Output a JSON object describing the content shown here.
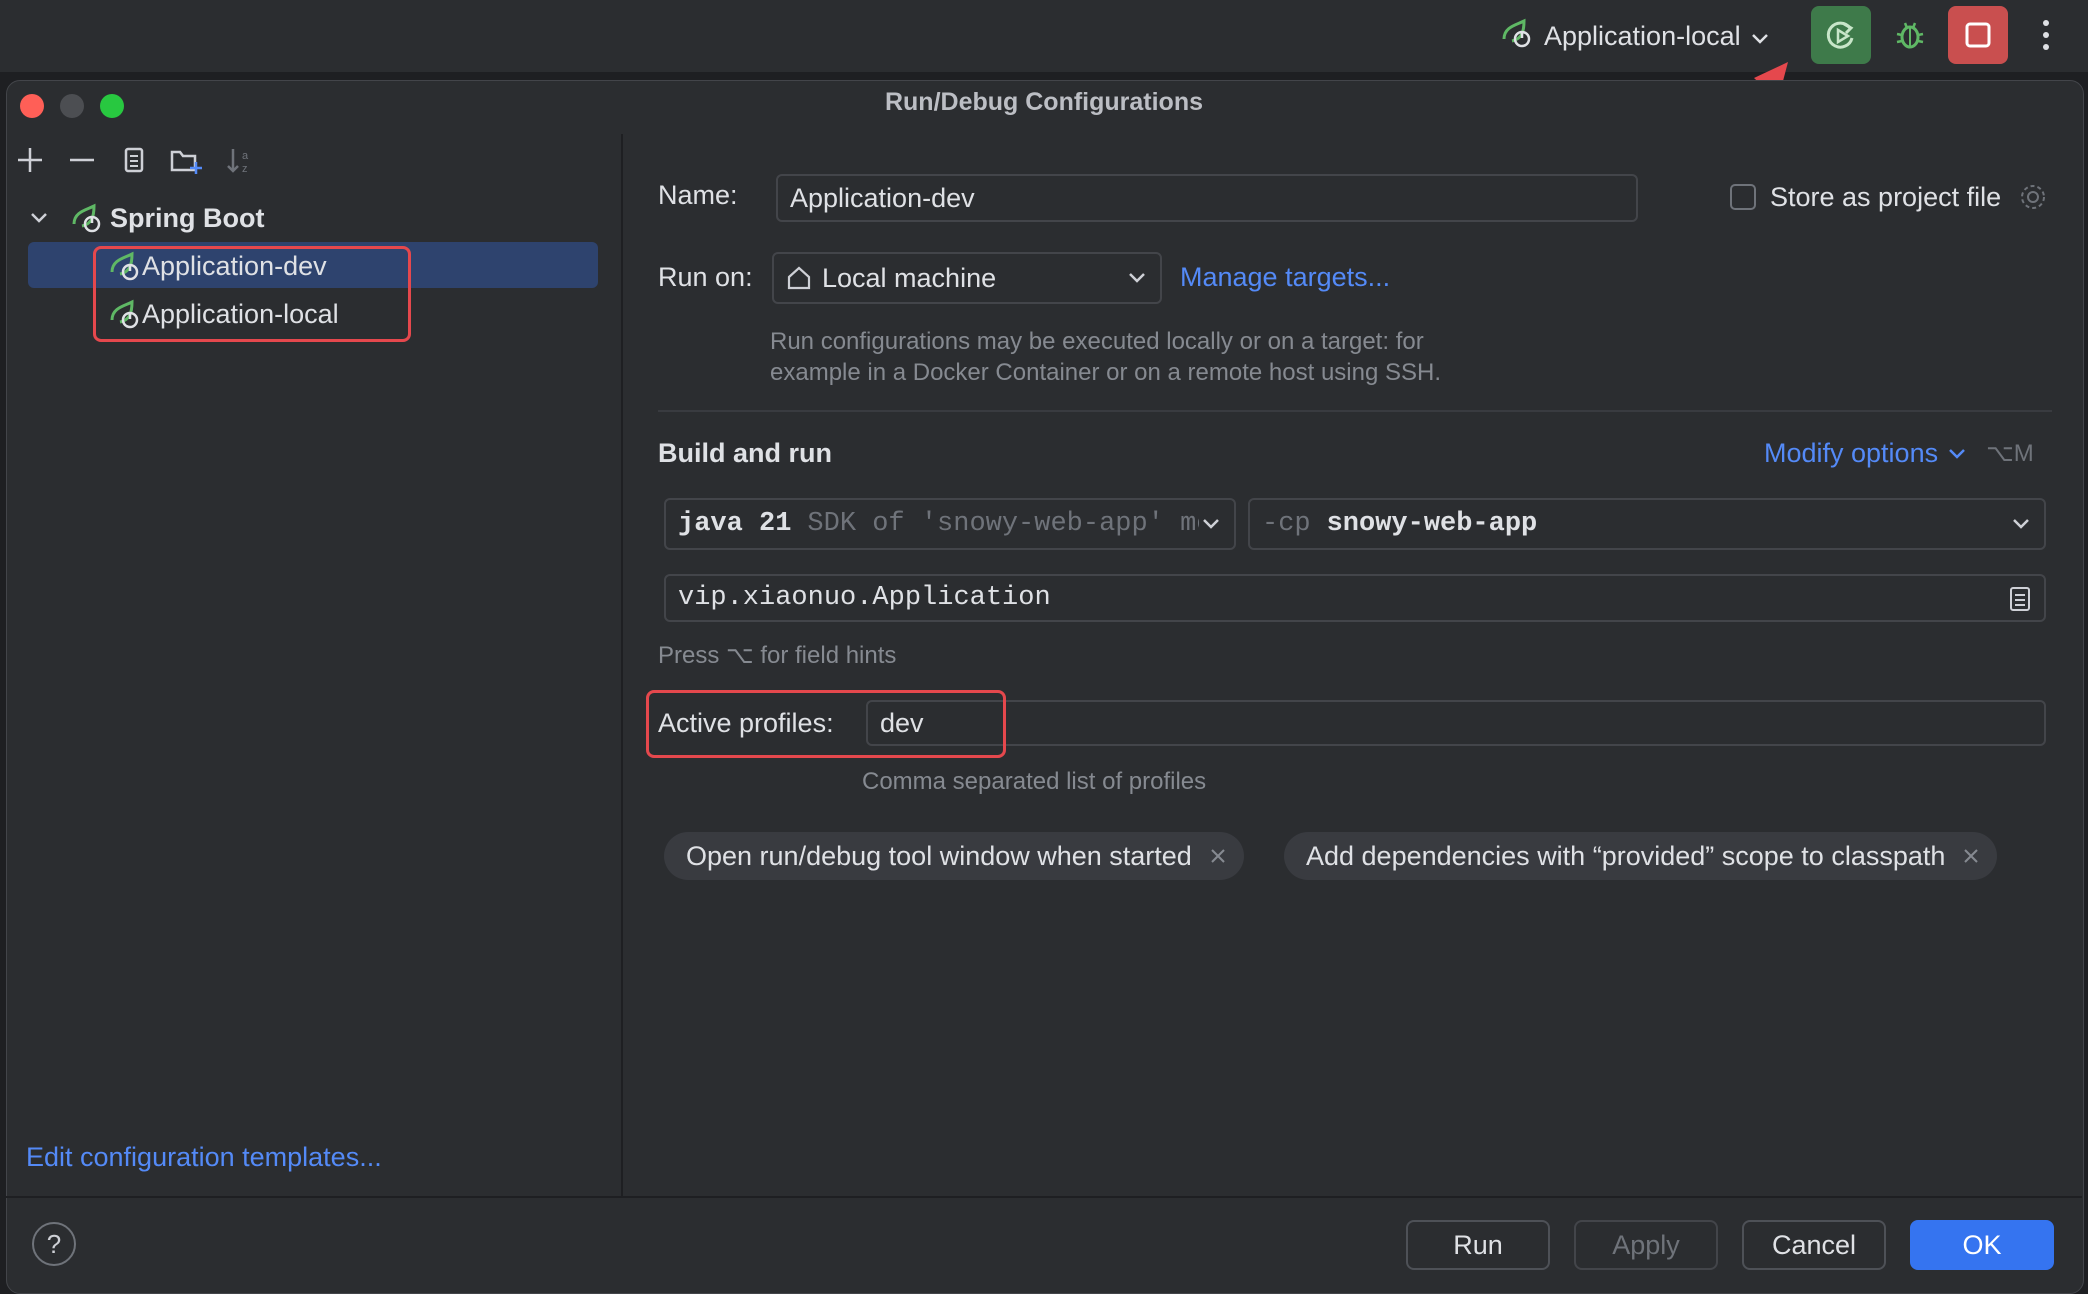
{
  "topbar": {
    "run_config_label": "Application-local"
  },
  "dialog": {
    "title": "Run/Debug Configurations"
  },
  "tree": {
    "group_label": "Spring Boot",
    "items": [
      {
        "label": "Application-dev",
        "selected": true
      },
      {
        "label": "Application-local",
        "selected": false
      }
    ],
    "edit_templates_link": "Edit configuration templates..."
  },
  "form": {
    "name_label": "Name:",
    "name_value": "Application-dev",
    "store_label": "Store as project file",
    "run_on_label": "Run on:",
    "run_on_value": "Local machine",
    "manage_targets_link": "Manage targets...",
    "run_on_hint_line1": "Run configurations may be executed locally or on a target: for",
    "run_on_hint_line2": "example in a Docker Container or on a remote host using SSH.",
    "build_and_run_label": "Build and run",
    "modify_options_label": "Modify options",
    "modify_options_shortcut": "⌥M",
    "jdk_strong": "java 21",
    "jdk_muted": "SDK of 'snowy-web-app' mo",
    "cp_prefix": "-cp",
    "cp_value": "snowy-web-app",
    "main_class_value": "vip.xiaonuo.Application",
    "field_hints_text": "Press ⌥ for field hints",
    "active_profiles_label": "Active profiles:",
    "active_profiles_value": "dev",
    "active_profiles_hint": "Comma separated list of profiles",
    "chips": [
      "Open run/debug tool window when started",
      "Add dependencies with “provided” scope to classpath"
    ]
  },
  "buttons": {
    "run": "Run",
    "apply": "Apply",
    "cancel": "Cancel",
    "ok": "OK",
    "help": "?"
  },
  "colors": {
    "accent": "#3574f0",
    "link": "#548af7",
    "run_green": "#3e7a4a",
    "stop_red": "#c94f4f",
    "annotation_red": "#e5484d",
    "selection": "#2e436e"
  }
}
